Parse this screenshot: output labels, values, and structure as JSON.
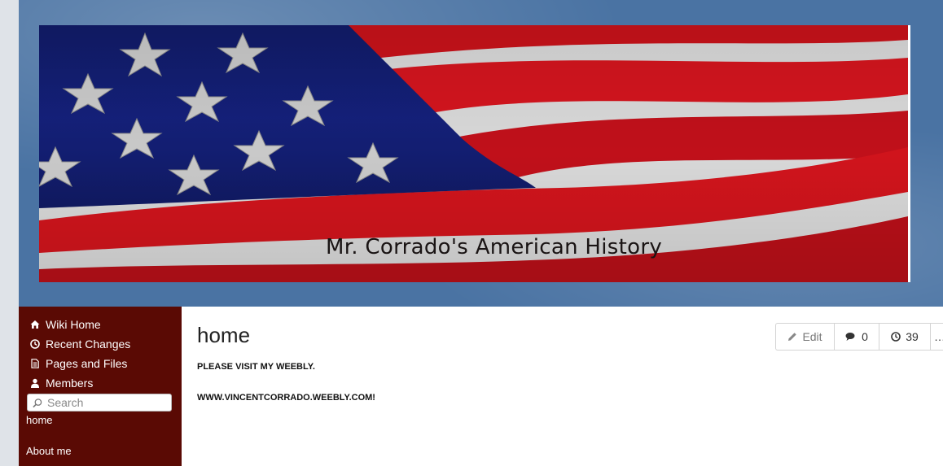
{
  "banner": {
    "title": "Mr. Corrado's American History"
  },
  "sidebar": {
    "nav": [
      {
        "label": "Wiki Home",
        "icon": "home-icon"
      },
      {
        "label": "Recent Changes",
        "icon": "clock-icon"
      },
      {
        "label": "Pages and Files",
        "icon": "document-icon"
      },
      {
        "label": "Members",
        "icon": "user-icon"
      }
    ],
    "search": {
      "placeholder": "Search"
    },
    "links": [
      "home",
      "About me"
    ]
  },
  "main": {
    "title": "home",
    "lines": [
      "PLEASE VISIT MY WEEBLY.",
      "WWW.VINCENTCORRADO.WEEBLY.COM!"
    ]
  },
  "toolbar": {
    "edit_label": "Edit",
    "comments_count": "0",
    "history_count": "39",
    "more_label": "…"
  },
  "colors": {
    "sidebar_bg": "#5a0a04",
    "header_bg": "#4a73a3"
  }
}
